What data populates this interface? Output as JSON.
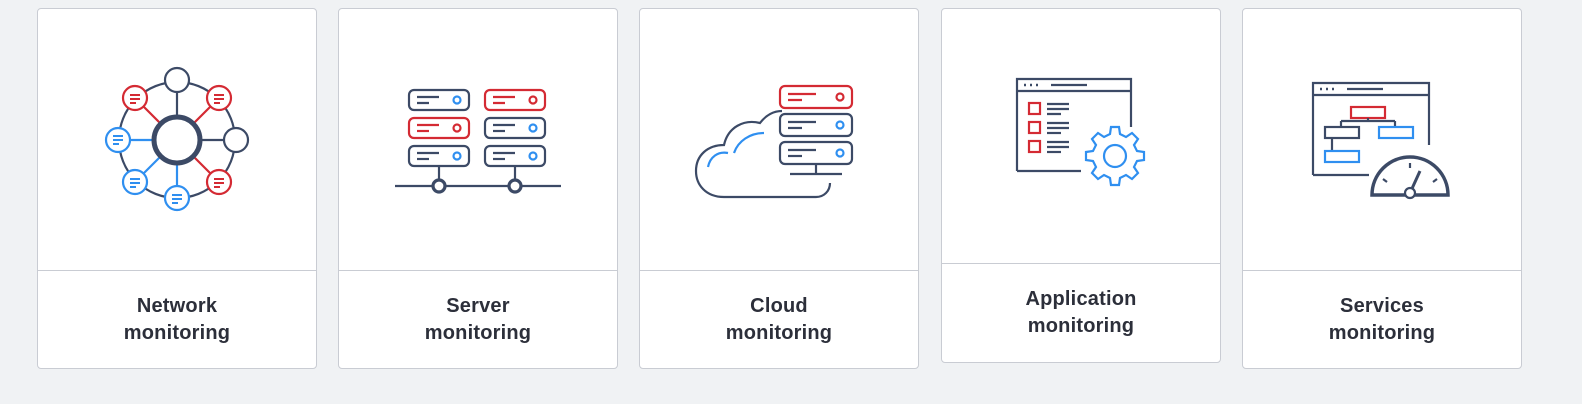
{
  "colors": {
    "navy": "#3c4a66",
    "red": "#d42a33",
    "blue": "#2f8ff0",
    "card_border": "#c9ccd3",
    "background": "#f0f2f4",
    "text": "#2c2f3a"
  },
  "cards": [
    {
      "line1": "Network",
      "line2": "monitoring",
      "icon": "network-icon"
    },
    {
      "line1": "Server",
      "line2": "monitoring",
      "icon": "server-rack-icon"
    },
    {
      "line1": "Cloud",
      "line2": "monitoring",
      "icon": "cloud-server-icon"
    },
    {
      "line1": "Application",
      "line2": "monitoring",
      "icon": "application-settings-icon"
    },
    {
      "line1": "Services",
      "line2": "monitoring",
      "icon": "services-dashboard-icon"
    }
  ]
}
